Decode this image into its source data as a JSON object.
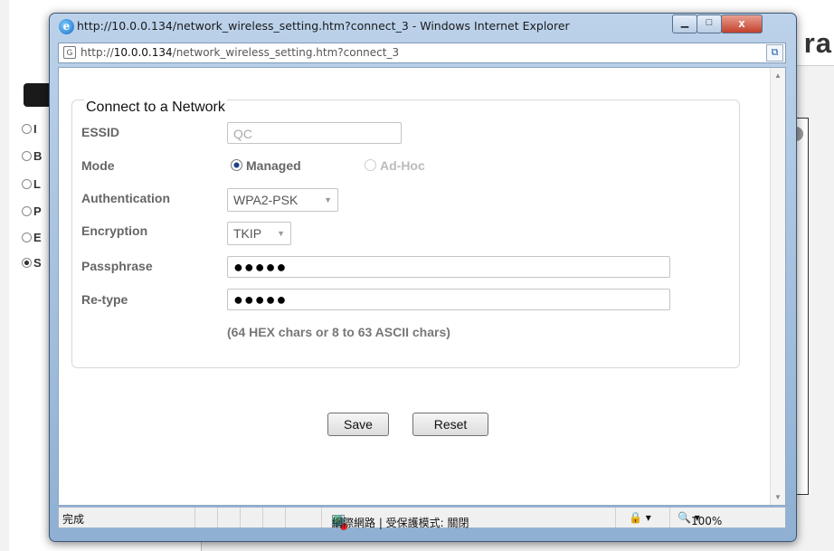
{
  "window": {
    "title": "http://10.0.0.134/network_wireless_setting.htm?connect_3 - Windows Internet Explorer",
    "min_icon": "minimize-icon",
    "max_icon": "maximize-icon",
    "close_icon": "close-icon"
  },
  "address_bar": {
    "url_prefix": "http://",
    "url_host": "10.0.0.134",
    "url_path": "/network_wireless_setting.htm?connect_3"
  },
  "background_page": {
    "title_fragment": "ra",
    "nav_items": [
      "I",
      "B",
      "L",
      "P",
      "E",
      "S"
    ],
    "selected_nav_index": 5
  },
  "form": {
    "legend": "Connect to a Network",
    "essid": {
      "label": "ESSID",
      "value": "QC"
    },
    "mode": {
      "label": "Mode",
      "options": [
        "Managed",
        "Ad-Hoc"
      ],
      "selected": "Managed"
    },
    "authentication": {
      "label": "Authentication",
      "value": "WPA2-PSK"
    },
    "encryption": {
      "label": "Encryption",
      "value": "TKIP"
    },
    "passphrase": {
      "label": "Passphrase",
      "value": "●●●●●"
    },
    "retype": {
      "label": "Re-type",
      "value": "●●●●●"
    },
    "hint": "(64 HEX chars or 8 to 63 ASCII chars)",
    "save_label": "Save",
    "reset_label": "Reset"
  },
  "status_bar": {
    "status_text": "完成",
    "zone_text": "網際網路 | 受保護模式: 關閉",
    "zoom": "100%"
  }
}
